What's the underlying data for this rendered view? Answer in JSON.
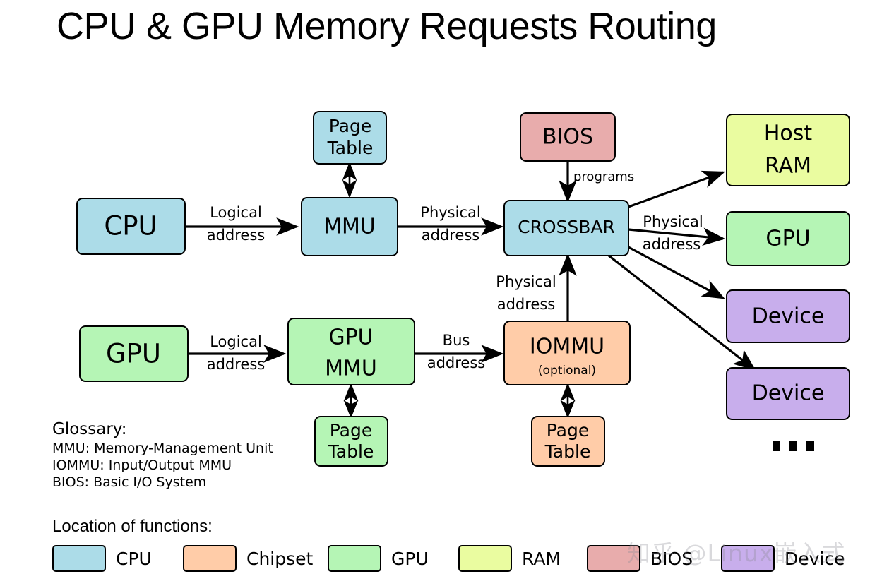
{
  "title": "CPU & GPU Memory Requests Routing",
  "colors": {
    "cpu": "#ACDCE8",
    "chipset": "#FFCCA8",
    "gpu": "#B5F5B5",
    "ram": "#EAFCA0",
    "bios": "#E8ACAC",
    "device": "#C8AEEC",
    "stroke": "#000000"
  },
  "nodes": {
    "cpu": {
      "label": "CPU",
      "category": "cpu"
    },
    "page_table_cpu": {
      "line1": "Page",
      "line2": "Table",
      "category": "cpu"
    },
    "mmu": {
      "label": "MMU",
      "category": "cpu"
    },
    "bios": {
      "label": "BIOS",
      "category": "bios"
    },
    "crossbar": {
      "label": "CROSSBAR",
      "category": "cpu"
    },
    "host_ram": {
      "line1": "Host",
      "line2": "RAM",
      "category": "ram"
    },
    "gpu_right": {
      "label": "GPU",
      "category": "gpu"
    },
    "device_1": {
      "label": "Device",
      "category": "device"
    },
    "device_2": {
      "label": "Device",
      "category": "device"
    },
    "gpu_left": {
      "label": "GPU",
      "category": "gpu"
    },
    "gpu_mmu": {
      "line1": "GPU",
      "line2": "MMU",
      "category": "gpu"
    },
    "page_table_gpu": {
      "line1": "Page",
      "line2": "Table",
      "category": "gpu"
    },
    "iommu": {
      "label": "IOMMU",
      "sublabel": "(optional)",
      "category": "chipset"
    },
    "page_table_iommu": {
      "line1": "Page",
      "line2": "Table",
      "category": "chipset"
    }
  },
  "edges": {
    "cpu_to_mmu": {
      "line1": "Logical",
      "line2": "address"
    },
    "mmu_to_crossbar": {
      "line1": "Physical",
      "line2": "address"
    },
    "bios_to_crossbar": {
      "label": "programs"
    },
    "crossbar_to_out": {
      "line1": "Physical",
      "line2": "address"
    },
    "gpu_to_gpummu": {
      "line1": "Logical",
      "line2": "address"
    },
    "gpummu_to_iommu": {
      "line1": "Bus",
      "line2": "address"
    },
    "iommu_to_crossbar": {
      "line1": "Physical",
      "line2": "address"
    }
  },
  "glossary": {
    "heading": "Glossary:",
    "lines": [
      "MMU: Memory-Management Unit",
      "IOMMU: Input/Output MMU",
      "BIOS: Basic I/O System"
    ]
  },
  "legend": {
    "heading": "Location of functions:",
    "items": [
      {
        "label": "CPU",
        "color": "#ACDCE8"
      },
      {
        "label": "Chipset",
        "color": "#FFCCA8"
      },
      {
        "label": "GPU",
        "color": "#B5F5B5"
      },
      {
        "label": "RAM",
        "color": "#EAFCA0"
      },
      {
        "label": "BIOS",
        "color": "#E8ACAC"
      },
      {
        "label": "Device",
        "color": "#C8AEEC"
      }
    ]
  },
  "watermark": "知乎 @Linux嵌入式",
  "ellipsis": "..."
}
